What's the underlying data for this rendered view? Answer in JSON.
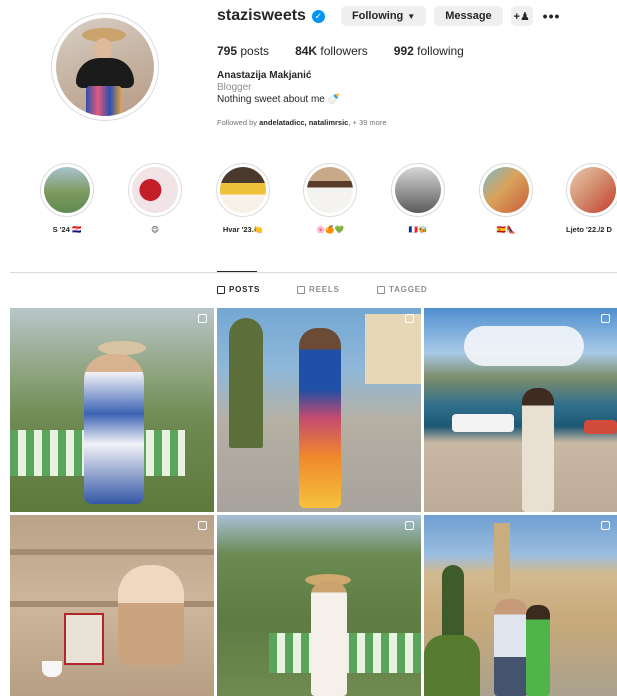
{
  "profile": {
    "username": "stazisweets",
    "following_button": "Following",
    "message_button": "Message",
    "stats": {
      "posts": "795",
      "posts_label": "posts",
      "followers": "84K",
      "followers_label": "followers",
      "following": "992",
      "following_label": "following"
    },
    "full_name": "Anastazija Makjanić",
    "category": "Blogger",
    "bio": "Nothing sweet about me 🍼",
    "followed_by_prefix": "Followed by",
    "followed_by_names": "andelatadicc, natalimrsic",
    "followed_by_suffix": "+ 39 more"
  },
  "highlights": [
    {
      "label": "S '24 🇭🇷"
    },
    {
      "label": "😊"
    },
    {
      "label": "Hvar '23.🍋"
    },
    {
      "label": "🌸🍊💚"
    },
    {
      "label": "🇫🇷🐝"
    },
    {
      "label": "🇪🇸👠"
    },
    {
      "label": "Ljeto '22./2 D"
    }
  ],
  "tabs": [
    {
      "label": "POSTS",
      "active": true
    },
    {
      "label": "REELS",
      "active": false
    },
    {
      "label": "TAGGED",
      "active": false
    }
  ],
  "icons": {
    "verified": "verified-badge-icon",
    "add_person": "add-person-icon",
    "more": "more-options-icon"
  },
  "colors": {
    "accent": "#0095f6",
    "button_bg": "#efefef",
    "text": "#262626",
    "muted": "#8e8e8e"
  }
}
